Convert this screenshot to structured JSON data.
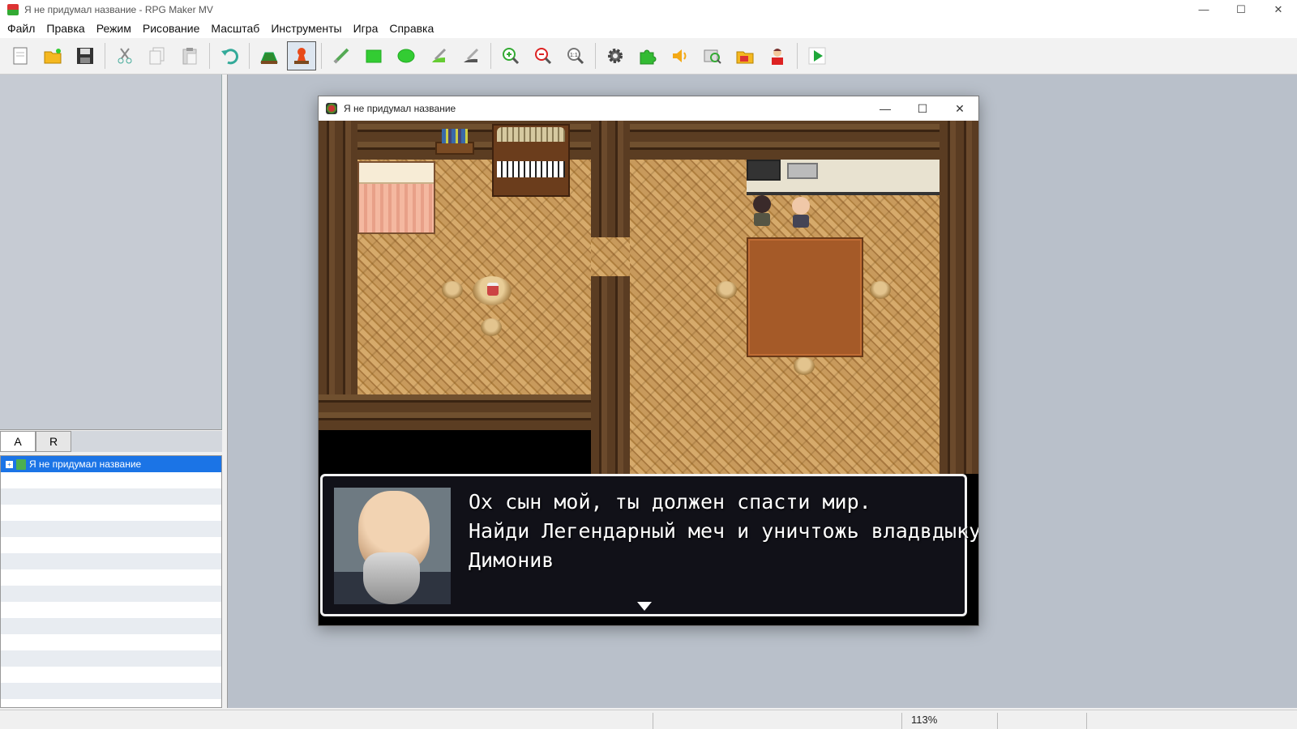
{
  "window": {
    "title": "Я не придумал название - RPG Maker MV",
    "controls": {
      "minimize": "—",
      "maximize": "☐",
      "close": "✕"
    }
  },
  "menu": [
    "Файл",
    "Правка",
    "Режим",
    "Рисование",
    "Масштаб",
    "Инструменты",
    "Игра",
    "Справка"
  ],
  "toolbar": {
    "groups": [
      [
        "new-project-icon",
        "open-project-icon",
        "save-project-icon"
      ],
      [
        "cut-icon",
        "copy-icon",
        "paste-icon"
      ],
      [
        "undo-icon"
      ],
      [
        "map-mode-icon",
        "event-mode-icon"
      ],
      [
        "pencil-icon",
        "rectangle-icon",
        "ellipse-icon",
        "fill-icon",
        "shadow-pen-icon"
      ],
      [
        "zoom-in-icon",
        "zoom-out-icon",
        "zoom-actual-icon"
      ],
      [
        "database-icon",
        "plugin-manager-icon",
        "sound-test-icon",
        "event-searcher-icon",
        "resource-manager-icon",
        "character-generator-icon"
      ],
      [
        "playtest-icon"
      ]
    ],
    "active": "event-mode-icon"
  },
  "left_panel": {
    "tabs": [
      "A",
      "R"
    ],
    "selected_tab": "A",
    "tree": {
      "selected_item": "Я не придумал название"
    }
  },
  "game_window": {
    "title": "Я не придумал название",
    "controls": {
      "minimize": "—",
      "maximize": "☐",
      "close": "✕"
    },
    "message": {
      "lines": [
        "Ох сын мой, ты должен спасти мир.",
        "Найди Легендарный меч и уничтожь владвдыку",
        "Димонив"
      ]
    }
  },
  "statusbar": {
    "zoom": "113%"
  },
  "colors": {
    "selection": "#1b74e6",
    "map_bg": "#b9c0ca",
    "playtest_green": "#1fa83a"
  }
}
